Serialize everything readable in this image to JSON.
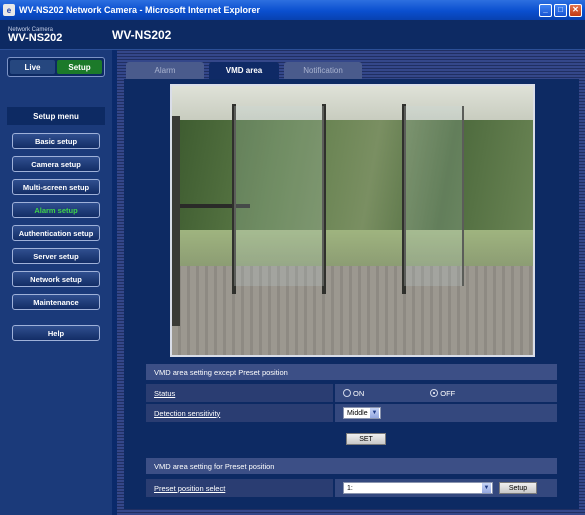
{
  "window": {
    "title": "WV-NS202 Network Camera - Microsoft Internet Explorer",
    "minimize": "_",
    "maximize": "□",
    "close": "✕"
  },
  "header": {
    "brand_small": "Network Camera",
    "brand_model": "WV-NS202",
    "model": "WV-NS202"
  },
  "mode_switch": {
    "live": "Live",
    "setup": "Setup"
  },
  "setup_menu": {
    "title": "Setup menu",
    "items": [
      {
        "label": "Basic setup"
      },
      {
        "label": "Camera setup"
      },
      {
        "label": "Multi-screen setup"
      },
      {
        "label": "Alarm setup"
      },
      {
        "label": "Authentication setup"
      },
      {
        "label": "Server setup"
      },
      {
        "label": "Network setup"
      },
      {
        "label": "Maintenance"
      }
    ],
    "help": "Help"
  },
  "tabs": [
    {
      "label": "Alarm"
    },
    {
      "label": "VMD area"
    },
    {
      "label": "Notification"
    }
  ],
  "vmd_except": {
    "title": "VMD area setting except Preset position",
    "status_label": "Status",
    "status_on": "ON",
    "status_off": "OFF",
    "status_value": "OFF",
    "sensitivity_label": "Detection sensitivity",
    "sensitivity_value": "Middle",
    "set_button": "SET"
  },
  "vmd_preset": {
    "title": "VMD area setting for Preset position",
    "preset_label": "Preset position select",
    "preset_value": "1:",
    "setup_button": "Setup"
  },
  "colors": {
    "active_menu": "#3ed24a",
    "setup_green": "#1c7a2a",
    "panel": "#0d2a63"
  }
}
